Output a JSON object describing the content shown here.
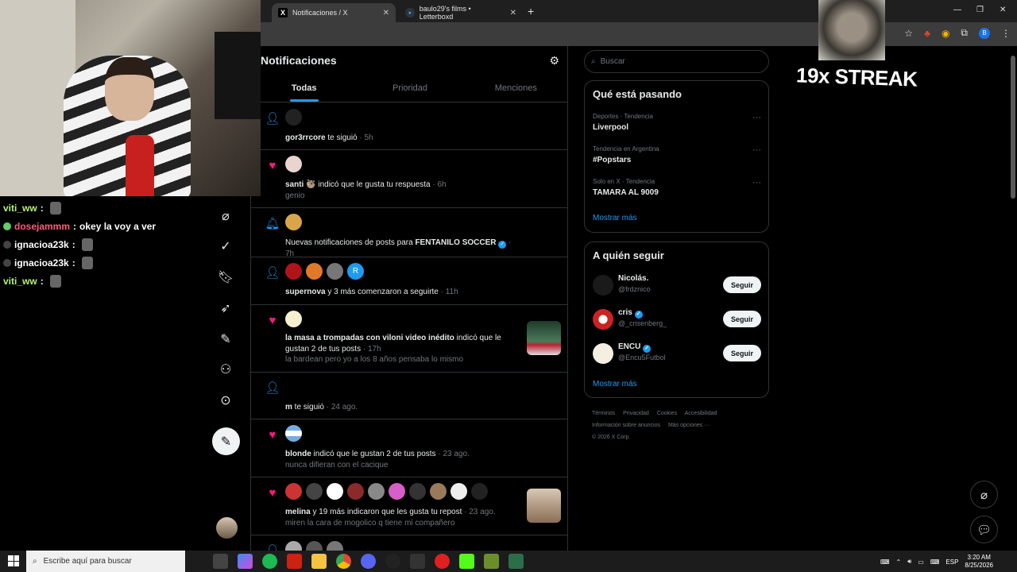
{
  "browser": {
    "tabs": [
      {
        "title": "Notificaciones / X",
        "favicon": "X",
        "active": true
      },
      {
        "title": "baulo29's films • Letterboxd",
        "favicon": "•",
        "active": false
      }
    ],
    "new_tab": "+",
    "window_controls": {
      "minimize": "—",
      "restore": "❐",
      "close": "✕"
    },
    "profile_letter": "B"
  },
  "overlay": {
    "streak": "19x STREAK",
    "chat": [
      {
        "user": "viti_ww",
        "message": "",
        "color": "#b7f26e"
      },
      {
        "user": "dosejammm",
        "message": "okey la voy a ver",
        "color": "#ff5c7a"
      },
      {
        "user": "ignacioa23k",
        "message": "",
        "color": "#ffffff"
      },
      {
        "user": "ignacioa23k",
        "message": "",
        "color": "#ffffff"
      },
      {
        "user": "viti_ww",
        "message": "",
        "color": "#b7f26e"
      }
    ]
  },
  "page": {
    "title": "Notificaciones",
    "tabs": [
      "Todas",
      "Prioridad",
      "Menciones"
    ]
  },
  "notifications": [
    {
      "type": "follow",
      "user": "gor3rrcore",
      "text": " te siguió",
      "time": "· 5h",
      "sub": ""
    },
    {
      "type": "like",
      "user": "santi 🦥",
      "text": " indicó que le gusta tu respuesta",
      "time": "· 6h",
      "sub": "genio"
    },
    {
      "type": "bell",
      "prefix": "Nuevas notificaciones de posts para ",
      "user": "FENTANILO SOCCER",
      "time": "· 7h"
    },
    {
      "type": "follow",
      "user": "supernova",
      "text": " y 3 más comenzaron a seguirte",
      "time": "· 11h",
      "avatar_letter": "R"
    },
    {
      "type": "like",
      "user": "la masa a trompadas con viloni video inédito",
      "text": " indicó que le gustan 2 de tus posts",
      "time": "· 17h",
      "sub": "la bardean pero yo a los 8 años pensaba lo mismo"
    },
    {
      "type": "follow",
      "user": "m",
      "text": " te siguió",
      "time": "· 24 ago.",
      "sub": ""
    },
    {
      "type": "like",
      "user": "blonde",
      "text": " indicó que le gustan 2 de tus posts",
      "time": "· 23 ago.",
      "sub": "nunca difieran con el cacique"
    },
    {
      "type": "like",
      "user": "melina",
      "text": " y 19 más indicaron que les gusta tu repost",
      "time": "· 23 ago.",
      "sub": "miren la cara de mogolico q tiene mi compañero"
    }
  ],
  "search": {
    "placeholder": "Buscar"
  },
  "trends": {
    "title": "Qué está pasando",
    "items": [
      {
        "meta": "Deportes · Tendencia",
        "name": "Liverpool"
      },
      {
        "meta": "Tendencia en Argentina",
        "name": "#Popstars"
      },
      {
        "meta": "Solo en X · Tendencia",
        "name": "TAMARA AL 9009"
      }
    ],
    "show_more": "Mostrar más"
  },
  "who_to_follow": {
    "title": "A quién seguir",
    "items": [
      {
        "name": "Nicolás.",
        "handle": "@frdznico",
        "button": "Seguir",
        "verified": false
      },
      {
        "name": "cris",
        "handle": "@_crisenberg_",
        "button": "Seguir",
        "verified": true
      },
      {
        "name": "ENCU",
        "handle": "@Encu5Futbol",
        "button": "Seguir",
        "verified": true
      }
    ],
    "show_more": "Mostrar más"
  },
  "footer": {
    "links": [
      "Términos",
      "Privacidad",
      "Cookies",
      "Accesibilidad",
      "Información sobre anuncios",
      "Más opciones ···"
    ],
    "copyright": "© 2026 X Corp."
  },
  "taskbar": {
    "search_placeholder": "Escribe aquí para buscar",
    "lang": "ESP",
    "time": "3:20 AM",
    "date": "8/25/2026"
  },
  "colors": {
    "accent": "#1d9bf0",
    "like": "#f91880",
    "bg": "#000000",
    "border": "#2f3336",
    "muted": "#71767b"
  }
}
